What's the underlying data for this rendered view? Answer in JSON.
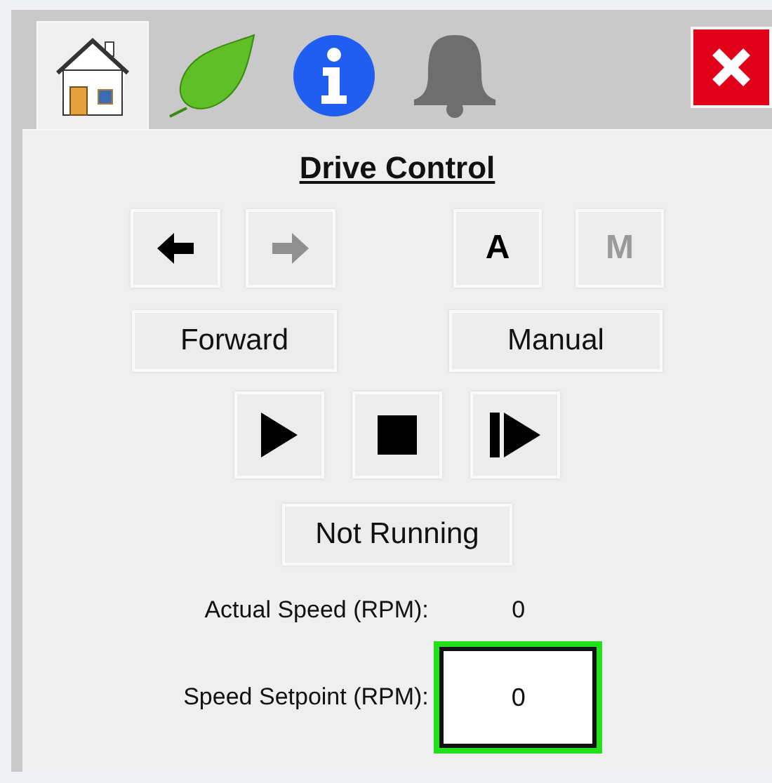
{
  "tabs": [
    {
      "kind": "home",
      "selected": true
    },
    {
      "kind": "leaf",
      "selected": false
    },
    {
      "kind": "info",
      "selected": false
    },
    {
      "kind": "bell",
      "selected": false
    }
  ],
  "title": "Drive Control",
  "direction_buttons": [
    {
      "kind": "left",
      "disabled": false
    },
    {
      "kind": "right",
      "disabled": true
    }
  ],
  "mode_buttons": [
    {
      "label": "A",
      "disabled": false
    },
    {
      "label": "M",
      "disabled": true
    }
  ],
  "direction_status": "Forward",
  "mode_status": "Manual",
  "run_buttons": [
    {
      "kind": "play"
    },
    {
      "kind": "stop"
    },
    {
      "kind": "step"
    }
  ],
  "run_status": "Not Running",
  "actual_speed": {
    "label": "Actual Speed (RPM):",
    "value": "0"
  },
  "speed_setpoint": {
    "label": "Speed Setpoint (RPM):",
    "value": "0",
    "focused": true
  }
}
